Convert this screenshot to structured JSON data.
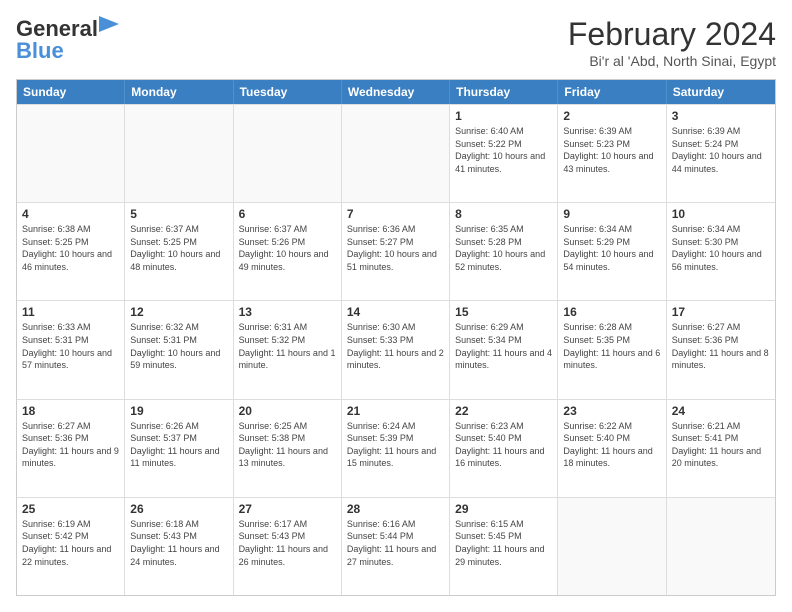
{
  "logo": {
    "line1": "General",
    "line2": "Blue"
  },
  "title": "February 2024",
  "subtitle": "Bi'r al 'Abd, North Sinai, Egypt",
  "header_days": [
    "Sunday",
    "Monday",
    "Tuesday",
    "Wednesday",
    "Thursday",
    "Friday",
    "Saturday"
  ],
  "weeks": [
    [
      {
        "day": "",
        "info": ""
      },
      {
        "day": "",
        "info": ""
      },
      {
        "day": "",
        "info": ""
      },
      {
        "day": "",
        "info": ""
      },
      {
        "day": "1",
        "info": "Sunrise: 6:40 AM\nSunset: 5:22 PM\nDaylight: 10 hours and 41 minutes."
      },
      {
        "day": "2",
        "info": "Sunrise: 6:39 AM\nSunset: 5:23 PM\nDaylight: 10 hours and 43 minutes."
      },
      {
        "day": "3",
        "info": "Sunrise: 6:39 AM\nSunset: 5:24 PM\nDaylight: 10 hours and 44 minutes."
      }
    ],
    [
      {
        "day": "4",
        "info": "Sunrise: 6:38 AM\nSunset: 5:25 PM\nDaylight: 10 hours and 46 minutes."
      },
      {
        "day": "5",
        "info": "Sunrise: 6:37 AM\nSunset: 5:25 PM\nDaylight: 10 hours and 48 minutes."
      },
      {
        "day": "6",
        "info": "Sunrise: 6:37 AM\nSunset: 5:26 PM\nDaylight: 10 hours and 49 minutes."
      },
      {
        "day": "7",
        "info": "Sunrise: 6:36 AM\nSunset: 5:27 PM\nDaylight: 10 hours and 51 minutes."
      },
      {
        "day": "8",
        "info": "Sunrise: 6:35 AM\nSunset: 5:28 PM\nDaylight: 10 hours and 52 minutes."
      },
      {
        "day": "9",
        "info": "Sunrise: 6:34 AM\nSunset: 5:29 PM\nDaylight: 10 hours and 54 minutes."
      },
      {
        "day": "10",
        "info": "Sunrise: 6:34 AM\nSunset: 5:30 PM\nDaylight: 10 hours and 56 minutes."
      }
    ],
    [
      {
        "day": "11",
        "info": "Sunrise: 6:33 AM\nSunset: 5:31 PM\nDaylight: 10 hours and 57 minutes."
      },
      {
        "day": "12",
        "info": "Sunrise: 6:32 AM\nSunset: 5:31 PM\nDaylight: 10 hours and 59 minutes."
      },
      {
        "day": "13",
        "info": "Sunrise: 6:31 AM\nSunset: 5:32 PM\nDaylight: 11 hours and 1 minute."
      },
      {
        "day": "14",
        "info": "Sunrise: 6:30 AM\nSunset: 5:33 PM\nDaylight: 11 hours and 2 minutes."
      },
      {
        "day": "15",
        "info": "Sunrise: 6:29 AM\nSunset: 5:34 PM\nDaylight: 11 hours and 4 minutes."
      },
      {
        "day": "16",
        "info": "Sunrise: 6:28 AM\nSunset: 5:35 PM\nDaylight: 11 hours and 6 minutes."
      },
      {
        "day": "17",
        "info": "Sunrise: 6:27 AM\nSunset: 5:36 PM\nDaylight: 11 hours and 8 minutes."
      }
    ],
    [
      {
        "day": "18",
        "info": "Sunrise: 6:27 AM\nSunset: 5:36 PM\nDaylight: 11 hours and 9 minutes."
      },
      {
        "day": "19",
        "info": "Sunrise: 6:26 AM\nSunset: 5:37 PM\nDaylight: 11 hours and 11 minutes."
      },
      {
        "day": "20",
        "info": "Sunrise: 6:25 AM\nSunset: 5:38 PM\nDaylight: 11 hours and 13 minutes."
      },
      {
        "day": "21",
        "info": "Sunrise: 6:24 AM\nSunset: 5:39 PM\nDaylight: 11 hours and 15 minutes."
      },
      {
        "day": "22",
        "info": "Sunrise: 6:23 AM\nSunset: 5:40 PM\nDaylight: 11 hours and 16 minutes."
      },
      {
        "day": "23",
        "info": "Sunrise: 6:22 AM\nSunset: 5:40 PM\nDaylight: 11 hours and 18 minutes."
      },
      {
        "day": "24",
        "info": "Sunrise: 6:21 AM\nSunset: 5:41 PM\nDaylight: 11 hours and 20 minutes."
      }
    ],
    [
      {
        "day": "25",
        "info": "Sunrise: 6:19 AM\nSunset: 5:42 PM\nDaylight: 11 hours and 22 minutes."
      },
      {
        "day": "26",
        "info": "Sunrise: 6:18 AM\nSunset: 5:43 PM\nDaylight: 11 hours and 24 minutes."
      },
      {
        "day": "27",
        "info": "Sunrise: 6:17 AM\nSunset: 5:43 PM\nDaylight: 11 hours and 26 minutes."
      },
      {
        "day": "28",
        "info": "Sunrise: 6:16 AM\nSunset: 5:44 PM\nDaylight: 11 hours and 27 minutes."
      },
      {
        "day": "29",
        "info": "Sunrise: 6:15 AM\nSunset: 5:45 PM\nDaylight: 11 hours and 29 minutes."
      },
      {
        "day": "",
        "info": ""
      },
      {
        "day": "",
        "info": ""
      }
    ]
  ]
}
